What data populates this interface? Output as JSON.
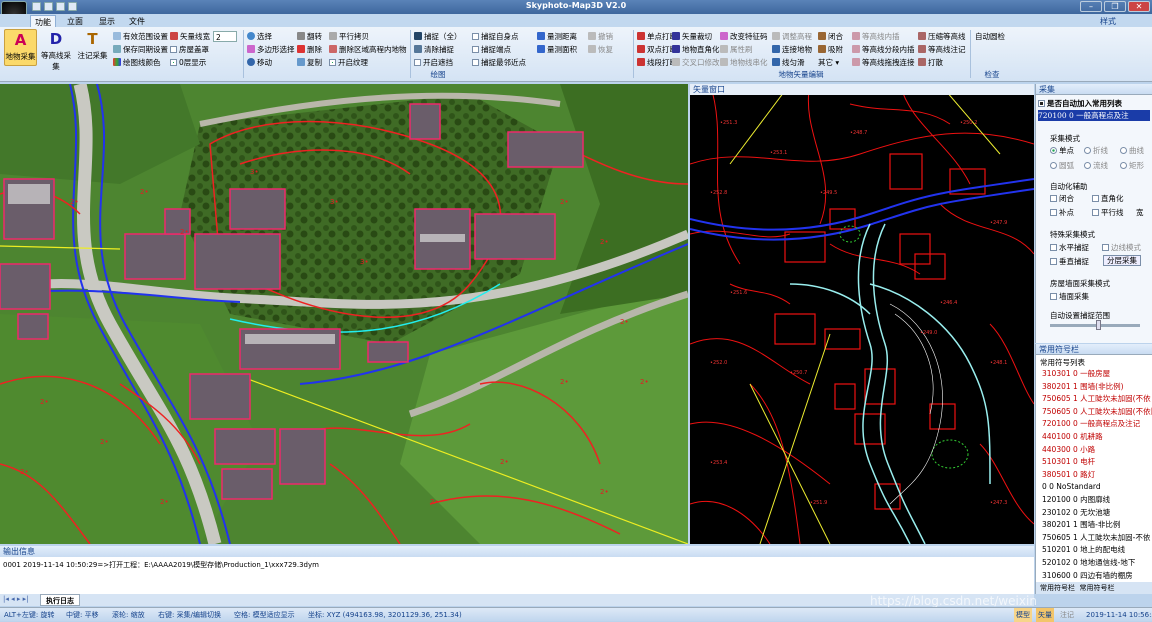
{
  "app": {
    "title": "Skyphoto-Map3D V2.0"
  },
  "window_controls": {
    "minimize": "–",
    "restore": "❐",
    "close": "✕"
  },
  "style_menu": "样式",
  "tabs": [
    "功能",
    "立面",
    "显示",
    "文件"
  ],
  "ribbon": {
    "big_buttons": [
      {
        "label": "地物采集",
        "icon": "A"
      },
      {
        "label": "等高线采集",
        "icon": "D"
      },
      {
        "label": "注记采集",
        "icon": "T"
      }
    ],
    "col1": [
      "有效范围设置",
      "保存同期设置",
      "绘图线颜色"
    ],
    "col2": {
      "vec_label": "矢量线宽",
      "vec_value": "2",
      "house": "房屋盖罩",
      "layer": "0层显示"
    },
    "col3": [
      "选择",
      "多边形选择",
      "移动"
    ],
    "col4": [
      "翻转",
      "删除",
      "复制"
    ],
    "col5": [
      "平行拷贝",
      "删除区域高程内地物",
      "开启纹理"
    ],
    "col6": [
      "捕捉（全）",
      "清除捕捉",
      "开启遮挡"
    ],
    "col7": [
      "捕捉自身点",
      "捕捉端点",
      "捕捉最邻近点"
    ],
    "col8": [
      "量测距离",
      "量测面积"
    ],
    "col9": [
      "撤销",
      "恢复"
    ],
    "group_draw": "绘图",
    "col10": [
      "单点打断",
      "双点打断",
      "线段打断"
    ],
    "col11": [
      "矢量裁切",
      "地物直角化",
      "交叉口修改"
    ],
    "col12": [
      "改变特征码",
      "属性刷",
      "地物线串化"
    ],
    "col13": [
      "调整高程",
      "连接地物",
      "线匀滑"
    ],
    "col14": [
      "闭合",
      "吸附",
      "其它"
    ],
    "col15": [
      "等高线内插",
      "等高线分段内插",
      "等高线拖拽连接"
    ],
    "col16": [
      "压缩等高线",
      "等高线注记",
      "打散"
    ],
    "group_edit": "地物矢量编辑",
    "col17": [
      "自动圆检"
    ],
    "group_check": "检查"
  },
  "vector_window": {
    "title": "矢量窗口"
  },
  "collect_panel": {
    "title": "采集",
    "auto_add": "是否自动加入常用列表",
    "code_select": "720100 0 一般高程点及注",
    "mode_title": "采集模式",
    "modes": [
      "单点",
      "折线",
      "曲线",
      "圆弧",
      "流线",
      "矩形"
    ],
    "assist_title": "自动化辅助",
    "assist": [
      "闭合",
      "直角化",
      "补点",
      "平行线",
      "宽"
    ],
    "special_title": "特殊采集模式",
    "special": [
      "水平捕捉",
      "边线模式",
      "垂直捕捉"
    ],
    "split_button": "分层采集",
    "wall_title": "房屋墙面采集模式",
    "wall": "墙面采集",
    "auto_range": "自动设置捕捉范围"
  },
  "symbol_panel": {
    "title": "常用符号栏",
    "list_title": "常用符号列表",
    "items": [
      {
        "text": "310301 0 一般房屋",
        "color": "#c00000"
      },
      {
        "text": "380201 1 围墙(非比例)",
        "color": "#c00000"
      },
      {
        "text": "750605 1 人工陡坎未加固(不依",
        "color": "#c00000"
      },
      {
        "text": "750605 0 人工陡坎未加固(不依比",
        "color": "#c00000"
      },
      {
        "text": "720100 0 一般高程点及注记",
        "color": "#c00000"
      },
      {
        "text": "440100 0 机耕路",
        "color": "#c00000"
      },
      {
        "text": "440300 0 小路",
        "color": "#c00000"
      },
      {
        "text": "510301 0 电杆",
        "color": "#c00000"
      },
      {
        "text": "380501 0 路灯",
        "color": "#c00000"
      },
      {
        "text": "0 0 NoStandard",
        "color": "#000000"
      },
      {
        "text": "120100 0 内图廓线",
        "color": "#000000"
      },
      {
        "text": "230102 0 无坎池塘",
        "color": "#000000"
      },
      {
        "text": "380201 1 围墙-非比例",
        "color": "#000000"
      },
      {
        "text": "750605 1 人工陡坎未加固-不依",
        "color": "#000000"
      },
      {
        "text": "510201 0 地上的配电线",
        "color": "#000000"
      },
      {
        "text": "520102 0 地地通信线-地下",
        "color": "#000000"
      },
      {
        "text": "310600 0 四边有墙的棚房",
        "color": "#000000"
      }
    ],
    "bottom_tabs": [
      "常用符号栏",
      "常用符号栏"
    ]
  },
  "output": {
    "title": "输出信息",
    "log": "0001  2019-11-14 10:50:29=>打开工程：E:\\AAAA2019\\模型存储\\Production_1\\xxx729.3dym",
    "tab": "执行日志"
  },
  "status": {
    "items": [
      "ALT+左键: 旋转",
      "中键: 平移",
      "滚轮: 缩放",
      "右键: 采集/编辑切换",
      "空格: 模型适应显示",
      "坐标: XYZ (494163.98, 3201129.36, 251.34)"
    ],
    "mode_buttons": [
      "模型",
      "矢量",
      "注记"
    ],
    "datetime": "2019-11-14 10:56:32"
  },
  "watermark": "https://blog.csdn.net/weixin_"
}
